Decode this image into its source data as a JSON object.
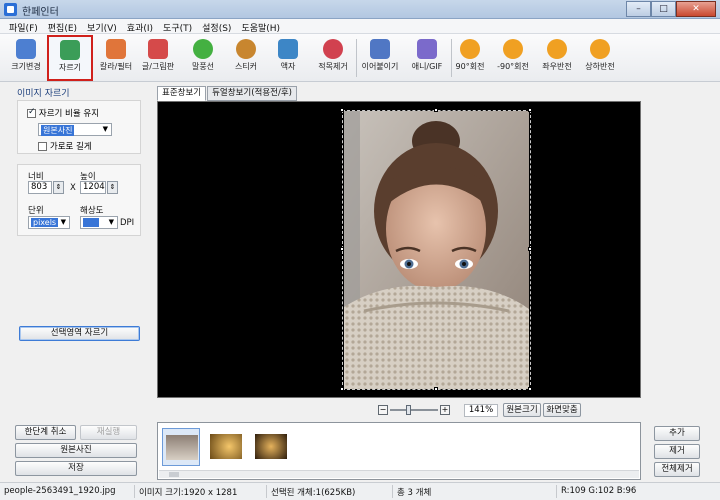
{
  "window": {
    "title": "한페인터",
    "minimize": "–",
    "maximize": "□",
    "close": "✕"
  },
  "menu": [
    "파일(F)",
    "편집(E)",
    "보기(V)",
    "효과(I)",
    "도구(T)",
    "설정(S)",
    "도움말(H)"
  ],
  "toolbar": [
    {
      "label": "크기변경",
      "color": "#4d7fd1"
    },
    {
      "label": "자르기",
      "color": "#3b9d58"
    },
    {
      "label": "칼라/필터",
      "color": "#e0753a"
    },
    {
      "label": "글/그림판",
      "color": "#d54a4a"
    },
    {
      "label": "말풍선",
      "color": "#44b041"
    },
    {
      "label": "스티커",
      "color": "#c8862f"
    },
    {
      "label": "액자",
      "color": "#3d86c6"
    },
    {
      "label": "적목제거",
      "color": "#d1414f"
    },
    {
      "label": "이어붙이기",
      "color": "#5077c4"
    },
    {
      "label": "애니/GIF",
      "color": "#7b6acb"
    },
    {
      "label": "90°회전",
      "color": "#f0a022"
    },
    {
      "label": "-90°회전",
      "color": "#f0a022"
    },
    {
      "label": "좌우반전",
      "color": "#f0a022"
    },
    {
      "label": "상하반전",
      "color": "#f0a022"
    }
  ],
  "left": {
    "section_title": "이미지 자르기",
    "keep_ratio_label": "자르기 비율 유지",
    "ratio_value": "원본사진",
    "landscape_label": "가로로 길게",
    "width_label": "너비",
    "height_label": "높이",
    "width_value": "803",
    "height_value": "1204",
    "x_label": "X",
    "unit_label": "단위",
    "resolution_label": "해상도",
    "unit_value": "pixels",
    "resolution_value": "",
    "dpi_label": "DPI",
    "crop_button": "선택영역 자르기",
    "undo_button": "한단계 취소",
    "redo_button": "재실행",
    "original_button": "원본사진",
    "save_button": "저장"
  },
  "view": {
    "tab_normal": "표준창보기",
    "tab_dual": "듀얼창보기(적용전/후)",
    "zoom": "141%",
    "btn_original_size": "원본크기",
    "btn_fit": "화면맞춤",
    "zoom_minus": "−",
    "zoom_plus": "+"
  },
  "right_buttons": {
    "add": "추가",
    "remove": "제거",
    "remove_all": "전체제거"
  },
  "status": {
    "filename": "people-2563491_1920.jpg",
    "image_size": "이미지 크기:1920 x 1281",
    "selected": "선택된 개체:1(625KB)",
    "total": "총 3 개체",
    "rgb": "R:109 G:102 B:96"
  }
}
